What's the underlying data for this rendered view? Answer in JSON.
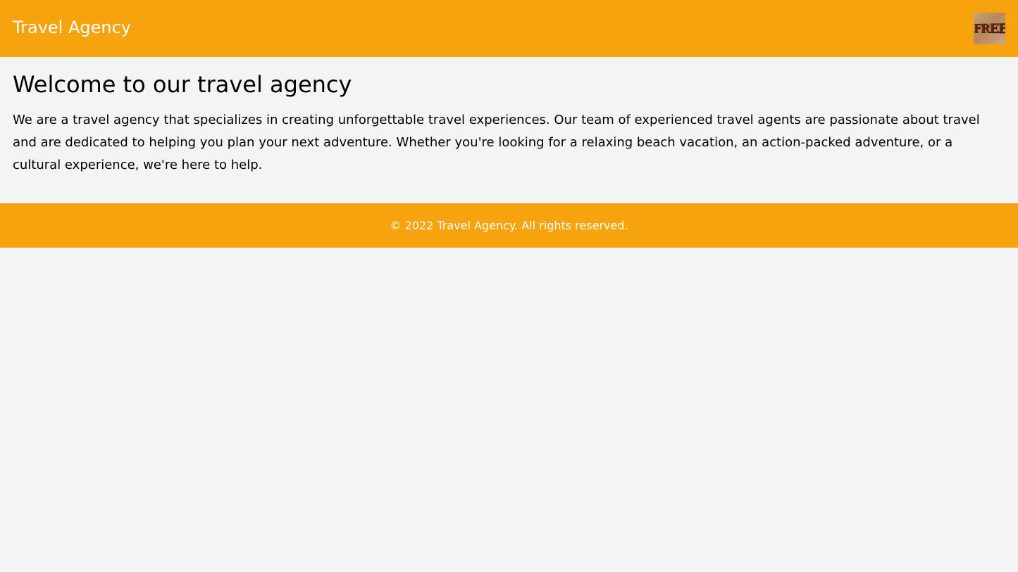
{
  "header": {
    "title": "Travel Agency",
    "logo_icon": "free-logo-icon",
    "logo_text": "FREE"
  },
  "main": {
    "heading": "Welcome to our travel agency",
    "intro": "We are a travel agency that specializes in creating unforgettable travel experiences. Our team of experienced travel agents are passionate about travel and are dedicated to helping you plan your next adventure. Whether you're looking for a relaxing beach vacation, an action-packed adventure, or a cultural experience, we're here to help."
  },
  "footer": {
    "copyright": "© 2022 Travel Agency. All rights reserved."
  },
  "colors": {
    "brand": "#f6a30e",
    "background": "#f3f4f6",
    "header_text": "#ffffff"
  }
}
